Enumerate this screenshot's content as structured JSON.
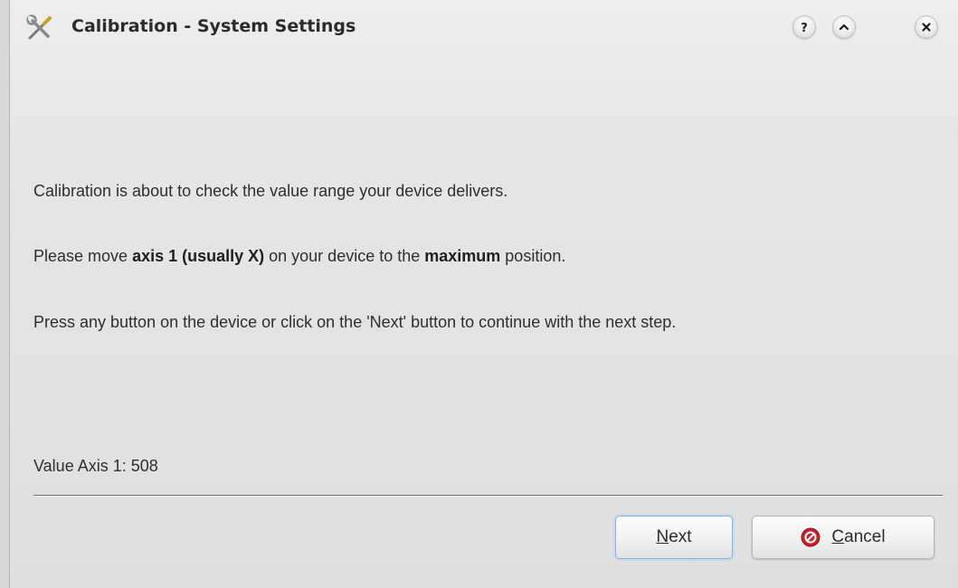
{
  "window": {
    "title": "Calibration - System Settings",
    "app_icon": "tools-icon",
    "titlebar_buttons": [
      {
        "name": "help",
        "icon": "question-icon",
        "glyph": "?"
      },
      {
        "name": "minimize",
        "icon": "chevron-up-icon"
      },
      {
        "name": "close",
        "icon": "close-icon"
      }
    ]
  },
  "content": {
    "line1": "Calibration is about to check the value range your device delivers.",
    "line2": {
      "part1": "Please move ",
      "bold1": "axis 1 (usually X)",
      "part2": " on your device to the ",
      "bold2": "maximum",
      "part3": " position."
    },
    "line3": "Press any button on the device or click on the 'Next' button to continue with the next step.",
    "value_label": "Value Axis 1:",
    "value": "508"
  },
  "buttons": {
    "next": {
      "mnemonic": "N",
      "rest": "ext"
    },
    "cancel": {
      "mnemonic": "C",
      "rest": "ancel",
      "icon": "cancel-icon"
    }
  },
  "colors": {
    "accent_focus": "#c5dbf2",
    "cancel_icon_red": "#c8202a"
  }
}
